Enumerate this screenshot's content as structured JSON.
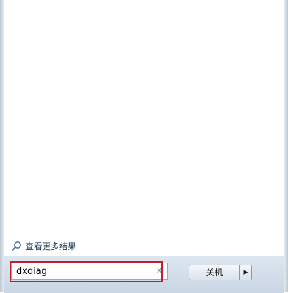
{
  "results": {
    "see_more_label": "查看更多结果"
  },
  "search": {
    "value": "dxdiag",
    "clear_glyph": "x"
  },
  "power": {
    "shutdown_label": "关机",
    "arrow_glyph": "▶"
  },
  "colors": {
    "highlight": "#c41e2b"
  }
}
